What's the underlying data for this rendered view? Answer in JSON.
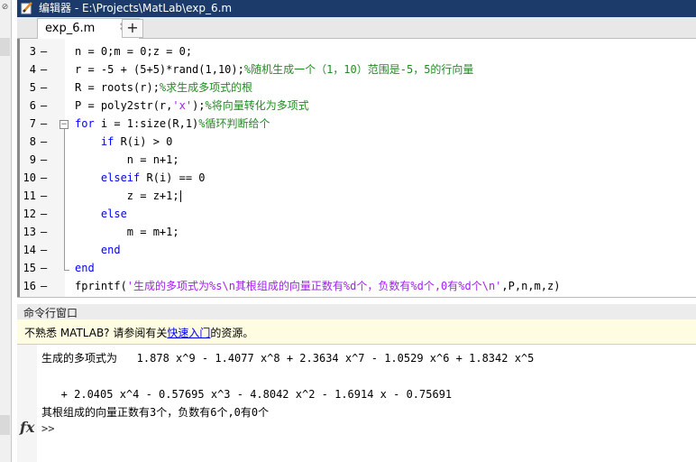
{
  "window": {
    "title": "编辑器 - E:\\Projects\\MatLab\\exp_6.m"
  },
  "tabs": [
    {
      "label": "exp_6.m",
      "close": "✖"
    }
  ],
  "tab_add": "+",
  "editor": {
    "lines": [
      {
        "n": "3",
        "dash": "–",
        "html": "n = 0;m = 0;z = 0;"
      },
      {
        "n": "4",
        "dash": "–",
        "html": "r = -5 + (5+5)*rand(1,10);<span class=\"cm\">%随机生成一个（1，10）范围是-5，5的行向量</span>"
      },
      {
        "n": "5",
        "dash": "–",
        "html": "R = roots(r);<span class=\"cm\">%求生成多项式的根</span>"
      },
      {
        "n": "6",
        "dash": "–",
        "html": "P = poly2str(r,<span class=\"str\">'x'</span>);<span class=\"cm\">%将向量转化为多项式</span>"
      },
      {
        "n": "7",
        "dash": "–",
        "html": "<span class=\"kw\">for</span> i = 1:size(R,1)<span class=\"cm\">%循环判断给个</span>"
      },
      {
        "n": "8",
        "dash": "–",
        "html": "    <span class=\"kw\">if</span> R(i) &gt; 0"
      },
      {
        "n": "9",
        "dash": "–",
        "html": "        n = n+1;"
      },
      {
        "n": "10",
        "dash": "–",
        "html": "    <span class=\"kw\">elseif</span> R(i) == 0"
      },
      {
        "n": "11",
        "dash": "–",
        "html": "        z = z+1;<span class=\"cursor\"></span>"
      },
      {
        "n": "12",
        "dash": "–",
        "html": "    <span class=\"kw\">else</span>"
      },
      {
        "n": "13",
        "dash": "–",
        "html": "        m = m+1;"
      },
      {
        "n": "14",
        "dash": "–",
        "html": "    <span class=\"kw\">end</span>"
      },
      {
        "n": "15",
        "dash": "–",
        "html": "<span class=\"kw\">end</span>"
      },
      {
        "n": "16",
        "dash": "–",
        "html": "fprintf(<span class=\"str\">'生成的多项式为%s\\n其根组成的向量正数有%d个，负数有%d个,0有%d个\\n'</span>,P,n,m,z)"
      }
    ]
  },
  "command_window": {
    "title": "命令行窗口",
    "info_prefix": "不熟悉 MATLAB? 请参阅有关",
    "info_link": "快速入门",
    "info_suffix": "的资源。",
    "output": [
      "生成的多项式为   1.878 x^9 - 1.4077 x^8 + 2.3634 x^7 - 1.0529 x^6 + 1.8342 x^5",
      "   + 2.0405 x^4 - 0.57695 x^3 - 4.8042 x^2 - 1.6914 x - 0.75691",
      "其根组成的向量正数有3个，负数有6个,0有0个"
    ],
    "fx": "fx",
    "prompt": ">>"
  }
}
